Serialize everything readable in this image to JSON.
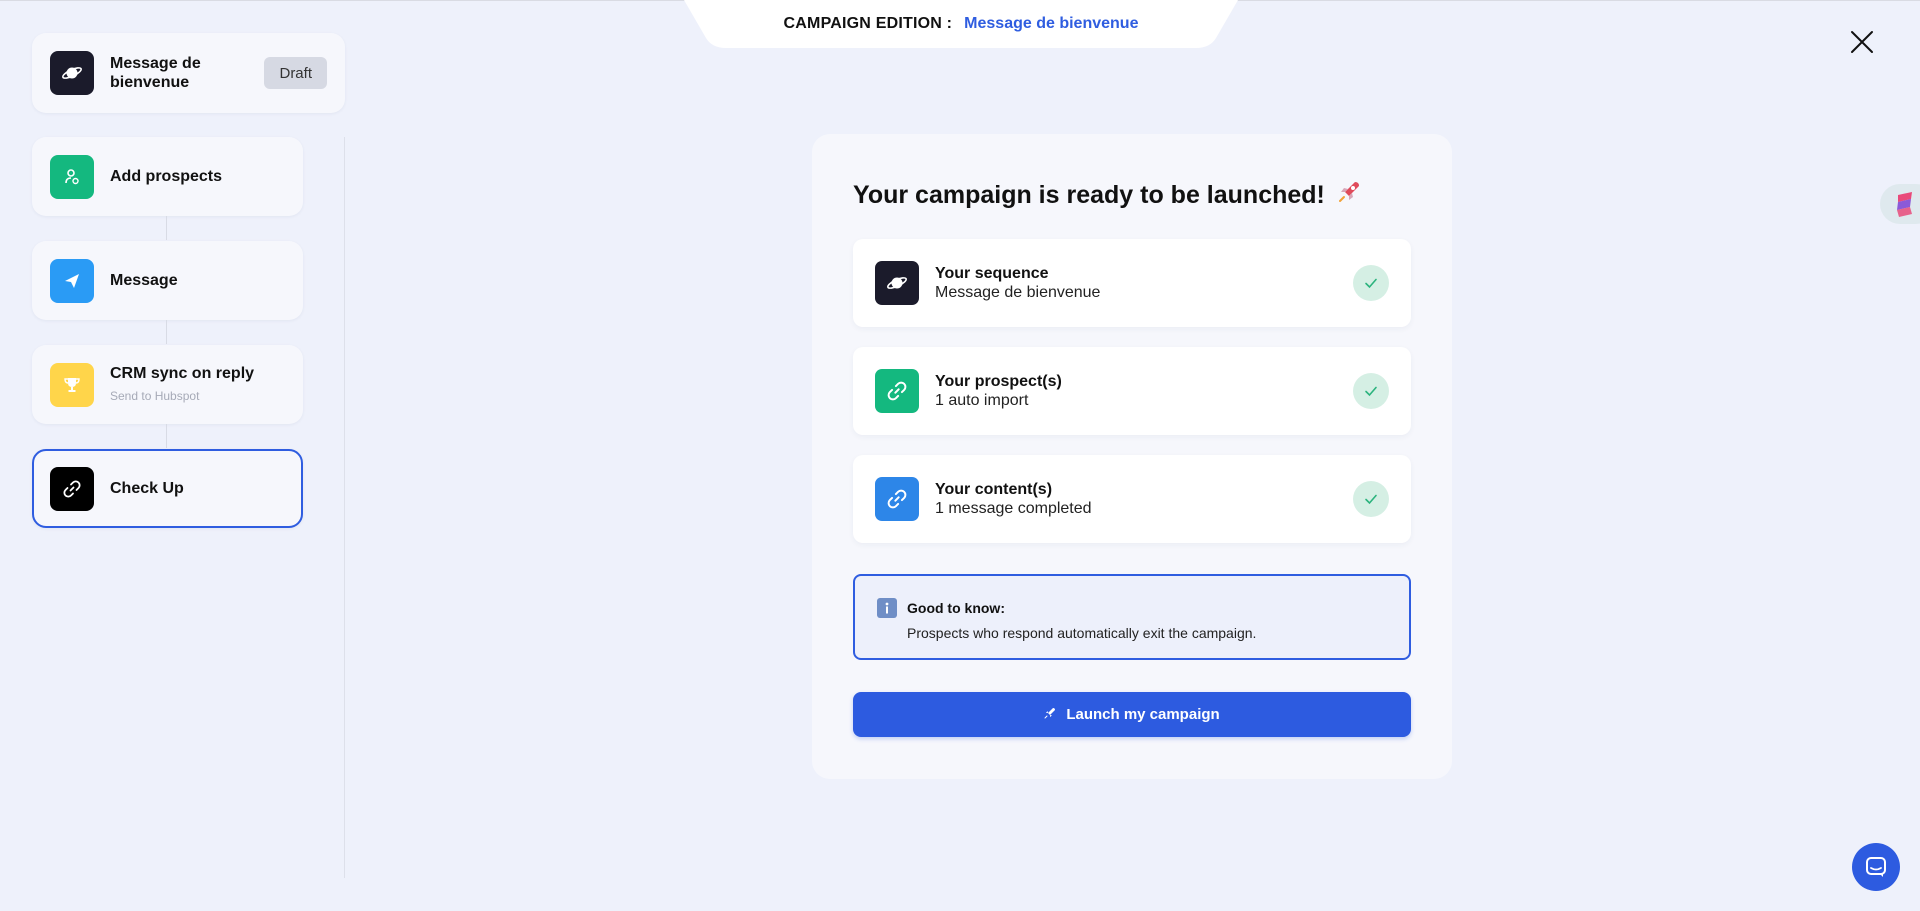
{
  "header": {
    "label": "CAMPAIGN EDITION :",
    "campaign_name": "Message de bienvenue"
  },
  "sidebar": {
    "campaign": {
      "title": "Message de bienvenue",
      "status": "Draft",
      "icon": "planet-icon"
    },
    "steps": [
      {
        "label": "Add prospects",
        "sub": "",
        "icon": "person-icon",
        "color": "#14b87f"
      },
      {
        "label": "Message",
        "sub": "",
        "icon": "paper-plane-icon",
        "color": "#2a9bf5"
      },
      {
        "label": "CRM sync on reply",
        "sub": "Send to Hubspot",
        "icon": "trophy-icon",
        "color": "#ffd54a"
      },
      {
        "label": "Check Up",
        "sub": "",
        "icon": "link-icon",
        "color": "#000000",
        "active": true
      }
    ]
  },
  "main": {
    "title": "Your campaign is ready to be launched!",
    "checks": [
      {
        "title": "Your sequence",
        "detail": "Message de bienvenue",
        "icon": "planet-icon",
        "color": "#1b1b2b"
      },
      {
        "title": "Your prospect(s)",
        "detail": "1 auto import",
        "icon": "link-icon",
        "color": "#14b87f"
      },
      {
        "title": "Your content(s)",
        "detail": "1 message completed",
        "icon": "link-icon",
        "color": "#2d86e8"
      }
    ],
    "info": {
      "title": "Good to know:",
      "text": "Prospects who respond automatically exit the campaign."
    },
    "launch_label": "Launch my campaign"
  },
  "colors": {
    "accent": "#2d5be0",
    "background": "#eef1fb",
    "success": "#d5efe4"
  }
}
